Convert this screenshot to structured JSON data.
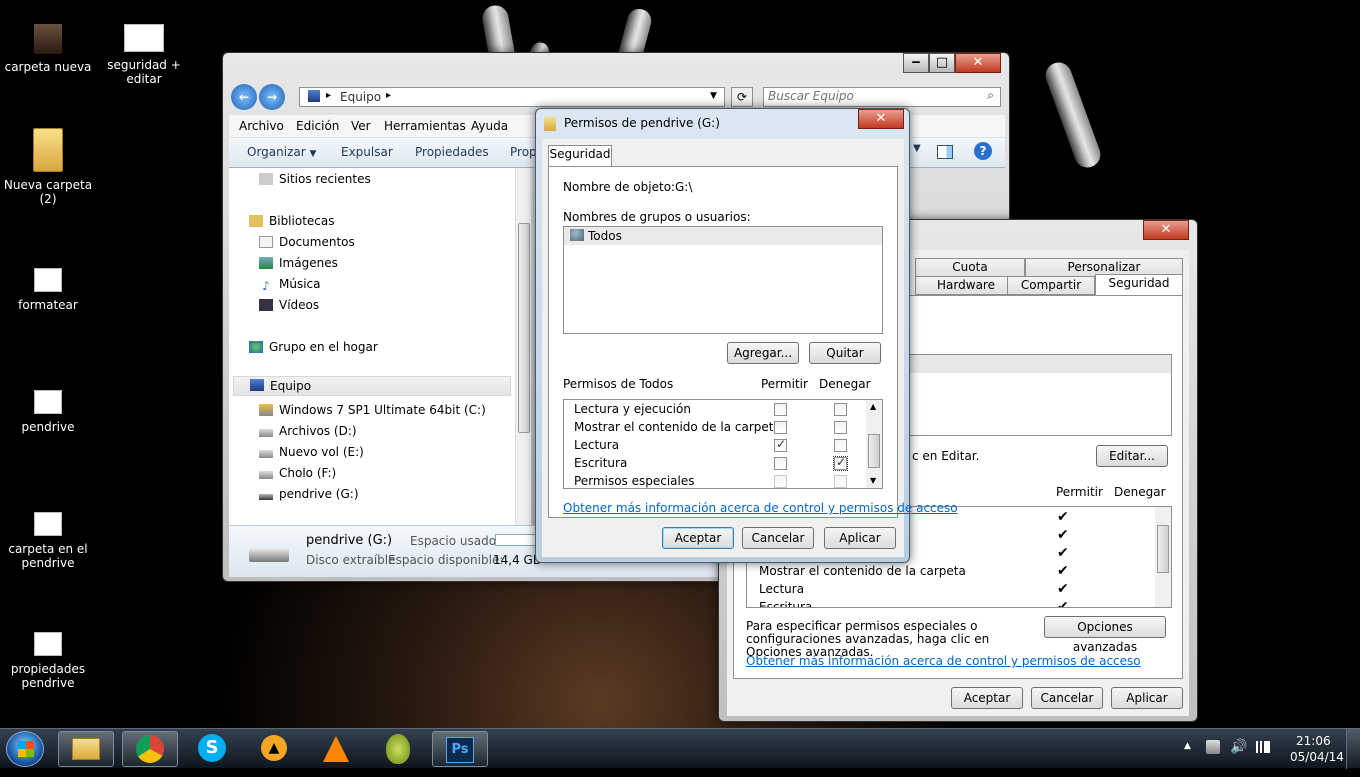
{
  "desktop": {
    "icons": [
      {
        "label": "carpeta nueva"
      },
      {
        "label": "seguridad + editar"
      },
      {
        "label": "Nueva carpeta (2)"
      },
      {
        "label": "formatear"
      },
      {
        "label": "pendrive"
      },
      {
        "label": "carpeta en el pendrive"
      },
      {
        "label": "propiedades pendrive"
      }
    ]
  },
  "explorer": {
    "address": "Equipo",
    "search_placeholder": "Buscar Equipo",
    "menu": [
      "Archivo",
      "Edición",
      "Ver",
      "Herramientas",
      "Ayuda"
    ],
    "toolbar": [
      "Organizar",
      "Expulsar",
      "Propiedades",
      "Prop"
    ],
    "nav": {
      "recent": "Sitios recientes",
      "libraries": "Bibliotecas",
      "documents": "Documentos",
      "images": "Imágenes",
      "music": "Música",
      "videos": "Vídeos",
      "homegroup": "Grupo en el hogar",
      "computer": "Equipo",
      "drive_c": "Windows 7 SP1 Ultimate 64bit (C:)",
      "drive_d": "Archivos (D:)",
      "drive_e": "Nuevo vol (E:)",
      "drive_f": "Cholo (F:)",
      "drive_g": "pendrive (G:)"
    },
    "details": {
      "name": "pendrive (G:)",
      "type": "Disco extraíble",
      "used_label": "Espacio usado:",
      "free_label": "Espacio disponible:",
      "free_value": "14,4 GB"
    }
  },
  "perm_dialog": {
    "title": "Permisos de pendrive (G:)",
    "tab": "Seguridad",
    "object_label": "Nombre de objeto:",
    "object_value": "G:\\",
    "groups_label": "Nombres de grupos o usuarios:",
    "groups": [
      "Todos"
    ],
    "add_button": "Agregar...",
    "remove_button": "Quitar",
    "perms_label": "Permisos de Todos",
    "allow_header": "Permitir",
    "deny_header": "Denegar",
    "rows": [
      {
        "name": "Lectura y ejecución",
        "allow": false,
        "deny": false,
        "disabled": false
      },
      {
        "name": "Mostrar el contenido de la carpeta",
        "allow": false,
        "deny": false,
        "disabled": false
      },
      {
        "name": "Lectura",
        "allow": true,
        "deny": false,
        "disabled": false
      },
      {
        "name": "Escritura",
        "allow": false,
        "deny": true,
        "disabled": false
      },
      {
        "name": "Permisos especiales",
        "allow": false,
        "deny": false,
        "disabled": true
      }
    ],
    "more_info_link": "Obtener más información acerca de control y permisos de acceso",
    "ok_button": "Aceptar",
    "cancel_button": "Cancelar",
    "apply_button": "Aplicar"
  },
  "props_window": {
    "tabs_top": [
      "Cuota",
      "Personalizar"
    ],
    "tabs_bottom": [
      "Hardware",
      "Compartir",
      "Seguridad"
    ],
    "edit_hint": "c en Editar.",
    "edit_button": "Editar...",
    "allow_header": "Permitir",
    "deny_header": "Denegar",
    "perm_rows": [
      "",
      "",
      "",
      "Mostrar el contenido de la carpeta",
      "Lectura",
      "Escritura"
    ],
    "advanced_text": "Para especificar permisos especiales o configuraciones avanzadas, haga clic en Opciones avanzadas.",
    "advanced_button": "Opciones avanzadas",
    "more_info_link": "Obtener más información acerca de control y permisos de acceso",
    "ok_button": "Aceptar",
    "cancel_button": "Cancelar",
    "apply_button": "Aplicar"
  },
  "taskbar": {
    "apps": [
      "start",
      "explorer",
      "chrome",
      "skype",
      "aimp",
      "vlc",
      "utorrent",
      "photoshop"
    ],
    "ps_label": "Ps",
    "time": "21:06",
    "date": "05/04/14"
  }
}
